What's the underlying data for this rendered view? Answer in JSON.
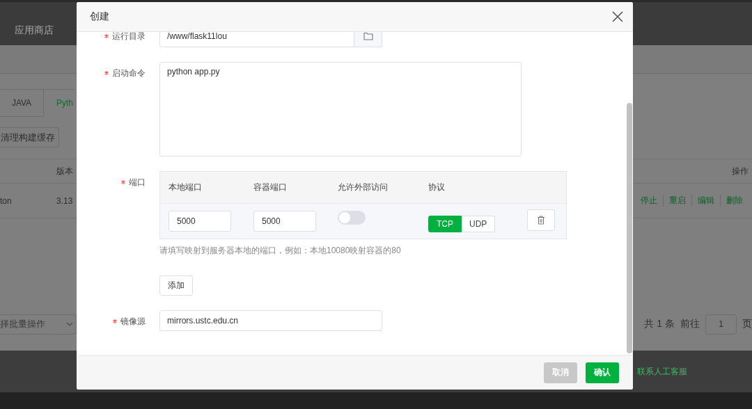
{
  "background": {
    "nav_item": "应用商店",
    "tabs": [
      {
        "label": "JAVA",
        "selected": false
      },
      {
        "label": "Pyth",
        "selected": true
      }
    ],
    "clear_cache_button": "清理构建缓存",
    "table": {
      "columns": [
        "版本",
        "操作"
      ],
      "rows": [
        {
          "name": "ton",
          "version": "3.13",
          "actions": [
            "停止",
            "重启",
            "编辑",
            "删除"
          ]
        }
      ]
    },
    "batch_select": {
      "placeholder": "择批量操作"
    },
    "pagination": {
      "total": "共 1 条",
      "goto": "前往",
      "page": "1",
      "unit": "页"
    },
    "footer_link": "联系人工客服"
  },
  "dialog": {
    "title": "创建",
    "fields": [
      {
        "kind": "path",
        "label": "运行目录",
        "required": true,
        "value": "/www/flask11lou"
      },
      {
        "kind": "textarea",
        "label": "启动命令",
        "required": true,
        "value": "python app.py"
      },
      {
        "kind": "ports",
        "label": "端口",
        "required": true,
        "columns": [
          "本地端口",
          "容器端口",
          "允许外部访问",
          "协议"
        ],
        "rows": [
          {
            "local_port": "5000",
            "container_port": "5000",
            "external_access": false,
            "protocols": [
              {
                "label": "TCP",
                "selected": true
              },
              {
                "label": "UDP",
                "selected": false
              }
            ]
          }
        ],
        "hint": "请填写映射到服务器本地的端口，例如：本地10080映射容器的80",
        "add_button": "添加"
      },
      {
        "kind": "text",
        "label": "镜像源",
        "required": true,
        "value": "mirrors.ustc.edu.cn"
      }
    ],
    "buttons": [
      {
        "kind": "cancel",
        "label": "取消"
      },
      {
        "kind": "confirm",
        "label": "确认"
      }
    ]
  }
}
